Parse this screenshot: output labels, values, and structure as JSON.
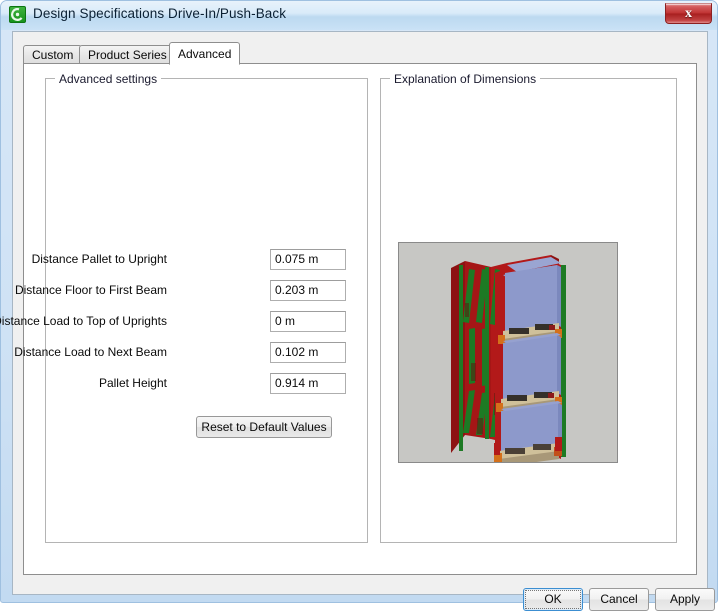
{
  "window": {
    "title": "Design Specifications Drive-In/Push-Back",
    "app_icon": "swirl-arrow-icon",
    "close_label": "x"
  },
  "tabs": [
    {
      "label": "Custom",
      "active": false
    },
    {
      "label": "Product Series",
      "active": false
    },
    {
      "label": "Advanced",
      "active": true
    }
  ],
  "groups": {
    "advanced": {
      "title": "Advanced settings"
    },
    "explanation": {
      "title": "Explanation of Dimensions"
    }
  },
  "fields": [
    {
      "label": "Distance Pallet to Upright",
      "value": "0.075 m"
    },
    {
      "label": "Distance Floor to First Beam",
      "value": "0.203 m"
    },
    {
      "label": "Distance Load to Top of Uprights",
      "value": "0 m"
    },
    {
      "label": "Distance Load to Next Beam",
      "value": "0.102 m"
    },
    {
      "label": "Pallet Height",
      "value": "0.914 m"
    }
  ],
  "reset_button": {
    "label": "Reset to Default Values"
  },
  "picture": {
    "name": "drive-in-pushback-rack-3d-render",
    "background": "#c7c7c4",
    "colors": {
      "load_blue": "#8d99cb",
      "load_blue_top": "#9aa5d2",
      "load_blue_dark": "#7b88bd",
      "upright_red": "#b21919",
      "upright_red_dark": "#8d1212",
      "rail_green": "#1d7a24",
      "pallet_tan": "#cfc09a",
      "pallet_tan_dark": "#a89878"
    }
  },
  "buttons": {
    "ok": "OK",
    "cancel": "Cancel",
    "apply": "Apply"
  }
}
